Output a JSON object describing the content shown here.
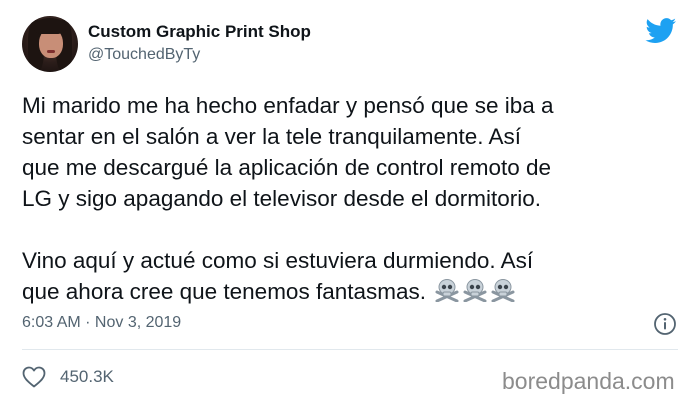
{
  "author": {
    "display_name": "Custom Graphic Print Shop",
    "handle": "@TouchedByTy"
  },
  "platform": {
    "icon": "twitter-bird-icon",
    "brand_color": "#1da1f2"
  },
  "tweet": {
    "paragraph_1": "Mi marido me ha hecho enfadar y pensó que se iba a\nsentar en el salón a ver la tele tranquilamente. Así\nque me descargué la aplicación de control remoto de\nLG y sigo apagando el televisor desde el dormitorio.",
    "paragraph_2": "Vino aquí y actué como si estuviera durmiendo. Así\nque ahora cree que tenemos fantasmas.",
    "emoji": [
      "skull-crossbones-icon",
      "skull-crossbones-icon",
      "skull-crossbones-icon"
    ]
  },
  "meta": {
    "timestamp": "6:03 AM · Nov 3, 2019",
    "info_icon": "info-icon"
  },
  "engagement": {
    "like_icon": "heart-icon",
    "likes": "450.3K"
  },
  "watermark": "boredpanda.com",
  "colors": {
    "text": "#0f1419",
    "secondary_text": "#536471",
    "divider": "#e1e8ed"
  }
}
